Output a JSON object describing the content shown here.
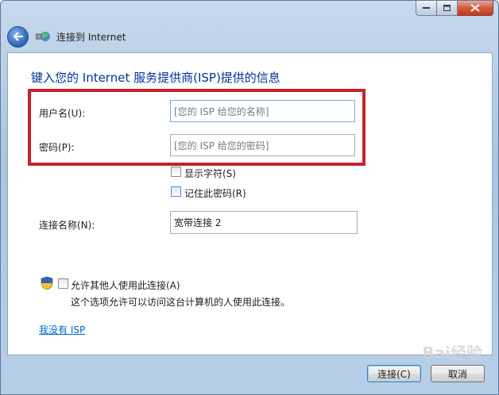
{
  "nav": {
    "title": "连接到 Internet"
  },
  "heading": "键入您的 Internet 服务提供商(ISP)提供的信息",
  "username": {
    "label": "用户名(U):",
    "placeholder": "[您的 ISP 给您的名称]"
  },
  "password": {
    "label": "密码(P):",
    "placeholder": "[您的 ISP 给您的密码]"
  },
  "show_chars": {
    "label": "显示字符(S)",
    "checked": false
  },
  "remember_pw": {
    "label": "记住此密码(R)",
    "checked": false
  },
  "conn_name": {
    "label": "连接名称(N):",
    "value": "宽带连接 2"
  },
  "allow_others": {
    "label": "允许其他人使用此连接(A)",
    "checked": false,
    "hint": "这个选项允许可以访问这台计算机的人使用此连接。"
  },
  "no_isp_link": "我没有 ISP",
  "buttons": {
    "connect": "连接(C)",
    "cancel": "取消"
  },
  "watermark": "Bai经验",
  "colors": {
    "highlight": "#c8222b",
    "heading": "#003399",
    "link": "#0066cc"
  }
}
